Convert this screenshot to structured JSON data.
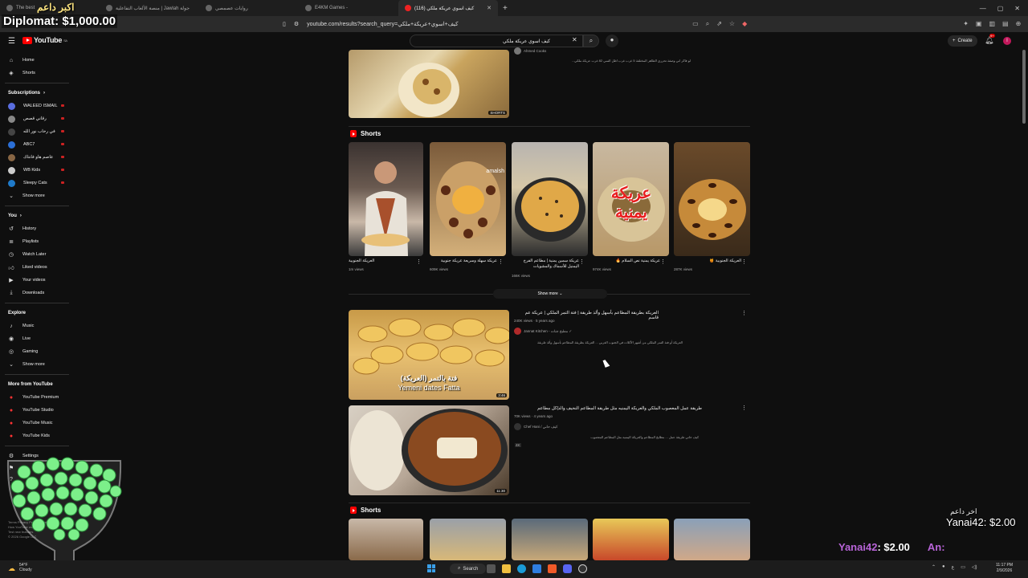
{
  "browser": {
    "tabs": [
      {
        "title": "The best"
      },
      {
        "title": "منصة الألعاب التفاعلية | Jawlah جولة"
      },
      {
        "title": "روايات عصمصي"
      },
      {
        "title": "E4KM Games - "
      },
      {
        "title": "(116) كيف اسوي عريكة ملكي",
        "active": true
      }
    ],
    "new_tab": "+",
    "url": "youtube.com/results?search_query=كيف+اسوي+عريكة+ملكي"
  },
  "overlay": {
    "top_text": "اكبر داعم",
    "top_amount": "Diplomat: $1,000.00"
  },
  "youtube": {
    "logo_text": "YouTube",
    "logo_sup": "SA",
    "search_value": "كيف اسوي عريكة ملكي",
    "create_label": "Create",
    "notif_count": "9+",
    "avatar_letter": "I"
  },
  "sidebar": {
    "home": "Home",
    "shorts": "Shorts",
    "subscriptions": "Subscriptions",
    "subs": [
      {
        "name": "WALEED ISMAIL",
        "color": "#5a6ee0"
      },
      {
        "name": "رقاني قصص",
        "color": "#888888"
      },
      {
        "name": "في رحاب نور الله",
        "color": "#444444"
      },
      {
        "name": "ABC7",
        "color": "#2b6fd6"
      },
      {
        "name": "عاصم هاو فانتاك",
        "color": "#886644"
      },
      {
        "name": "WB Kids",
        "color": "#cccccc"
      },
      {
        "name": "Sleepy Cats",
        "color": "#1f7ac9"
      }
    ],
    "show_more": "Show more",
    "you": "You",
    "you_items": [
      "History",
      "Playlists",
      "Watch Later",
      "Liked videos",
      "Your videos",
      "Downloads"
    ],
    "explore": "Explore",
    "explore_items": [
      "Music",
      "Live",
      "Gaming"
    ],
    "show_more2": "Show more",
    "more_from": "More from YouTube",
    "more_items": [
      "YouTube Premium",
      "YouTube Studio",
      "YouTube Music",
      "YouTube Kids"
    ],
    "settings": "Settings",
    "footer_lines": [
      "Terms  Privacy  Policy & Safety",
      "How YouTube works",
      "Test new features",
      "© 2026 Google LLC"
    ]
  },
  "results": {
    "top_result": {
      "channel": "Ahmed Cooks",
      "desc": "لو فاكر اني وصفة تحرري الطاهر المختلفة 5 غرب غرب اطل السي 82 غرب عريكة ملكي...",
      "badge": "SHORTS"
    },
    "shorts_shelf_1": {
      "title": "Shorts",
      "items": [
        {
          "title": "العريكة الجنوبية",
          "views": "1m views"
        },
        {
          "title": "عريكة سهلة وسريعة عريكة جنوبية",
          "views": "609K views"
        },
        {
          "title": "عريكة سمين يمنية | مطاعم الفرح اليمنيل للأسماك والمشويات",
          "views": "166K views"
        },
        {
          "title": "عريكة يمنية نص السلام 🔥",
          "views": "974K views"
        },
        {
          "title": "العريكة الجنوبية 🍯",
          "views": "287K views"
        }
      ],
      "short_overlays": [
        "",
        "amalsh",
        "",
        "عريكة يمنية",
        ""
      ]
    },
    "show_more": "Show more",
    "video1": {
      "title": "العريكة بطريقة المطاعم بأسهل وألذ طريقة | فتة التمر الملكي | عريكة عم قاسم",
      "meta": "240K views · 5 years ago",
      "channel": "Jannat Kitchen - مطبخ جنات",
      "desc": "العريكة أو فتة التمر الملكي من أشهر الأكلات في الجنوب العربي ... العريكة بطريقة المطاعم بأسهل وألذ طريقة",
      "thumb_text_ar": "فتة بالتمر (العريكة)",
      "thumb_text_en": "Yemeni dates Fatta",
      "duration": "3:46"
    },
    "video2": {
      "title": "طريقة عمل المعصوب الملكي والعريكة اليمنيه مثل طريقة المطاعم النحيف والذ|كل مطاعم",
      "meta": "70K views · 4 years ago",
      "channel": "Chef Hani / كيف حاني",
      "desc": "كيف حاني طريقة عمل ... مطابخ المطاعم والعريكة اليمنيه مثل المطاعم المعصوب",
      "badge": "4K",
      "duration": "11:30"
    },
    "shorts_shelf_2": {
      "title": "Shorts"
    }
  },
  "donations": {
    "top_ar": "اخر داعم",
    "top_amount": "Yanai42: $2.00",
    "bar_name": "Yanai42",
    "bar_amount": ": $2.00",
    "bar_name2": "An:"
  },
  "taskbar": {
    "search": "Search",
    "time": "11:17 PM",
    "date": "2/9/2026",
    "weather_temp": "54°F",
    "weather_cond": "Cloudy"
  }
}
